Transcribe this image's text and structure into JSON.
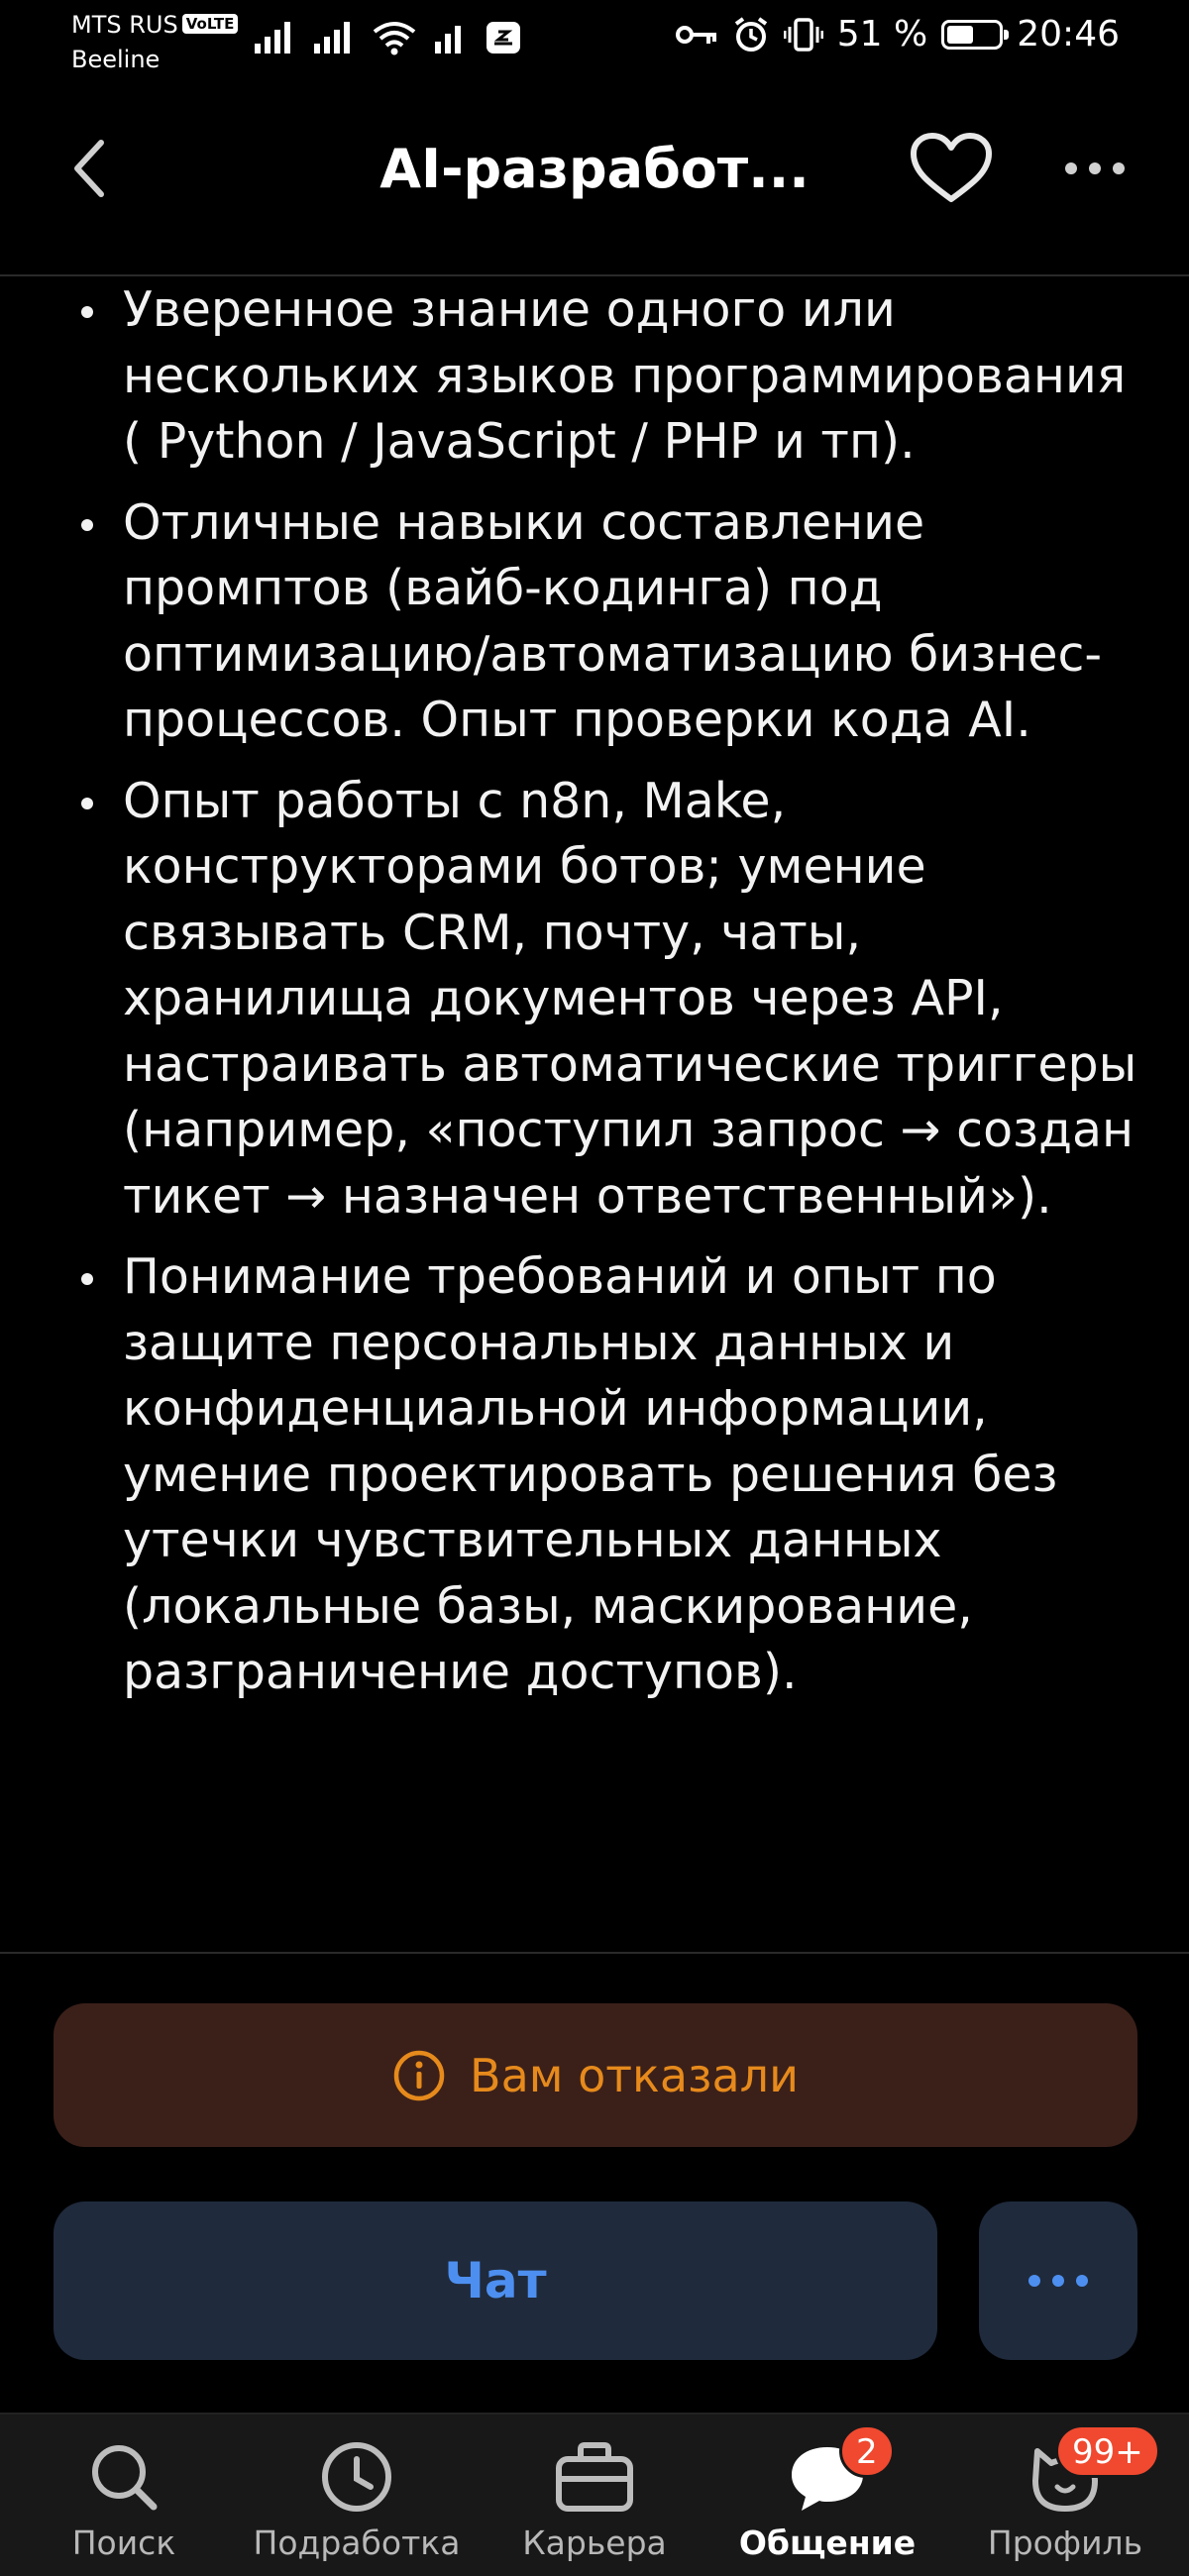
{
  "status_bar": {
    "carrier_primary": "MTS RUS",
    "volte_badge": "VoLTE",
    "carrier_secondary": "Beeline",
    "battery_percent": "51 %",
    "battery_level": 0.51,
    "time": "20:46"
  },
  "header": {
    "title": "AI-разработ..."
  },
  "content": {
    "bullets": [
      "Уверенное знание одного или нескольких языков программирования ( Python / JavaScript / PHP и тп).",
      "Отличные навыки составление промптов (вайб-кодинга) под оптимизацию/автоматизацию бизнес-процессов. Опыт проверки кода AI.",
      "Опыт работы с n8n, Make, конструкторами ботов; умение связывать CRM, почту, чаты, хранилища документов через API, настраивать автоматические триггеры (например, «поступил запрос → создан тикет → назначен ответственный»).",
      "Понимание требований и опыт по защите персональных данных и конфиденциальной информации, умение проектировать решения без утечки чувствительных данных (локальные базы, маскирование, разграничение доступов)."
    ]
  },
  "status_banner": {
    "text": "Вам отказали",
    "icon": "info-icon",
    "color": "#e68a1c"
  },
  "actions": {
    "chat_label": "Чат",
    "more_icon": "more-horizontal-icon"
  },
  "bottom_nav": {
    "items": [
      {
        "label": "Поиск",
        "icon": "search-icon"
      },
      {
        "label": "Подработка",
        "icon": "clock-icon"
      },
      {
        "label": "Карьера",
        "icon": "briefcase-icon"
      },
      {
        "label": "Общение",
        "icon": "chat-bubble-icon",
        "badge": "2",
        "active": true
      },
      {
        "label": "Профиль",
        "icon": "profile-cat-icon",
        "badge": "99+"
      }
    ]
  },
  "colors": {
    "accent_blue": "#4d8ff0",
    "warning_orange": "#e68a1c",
    "badge_red": "#f0492f",
    "background": "#000000"
  }
}
